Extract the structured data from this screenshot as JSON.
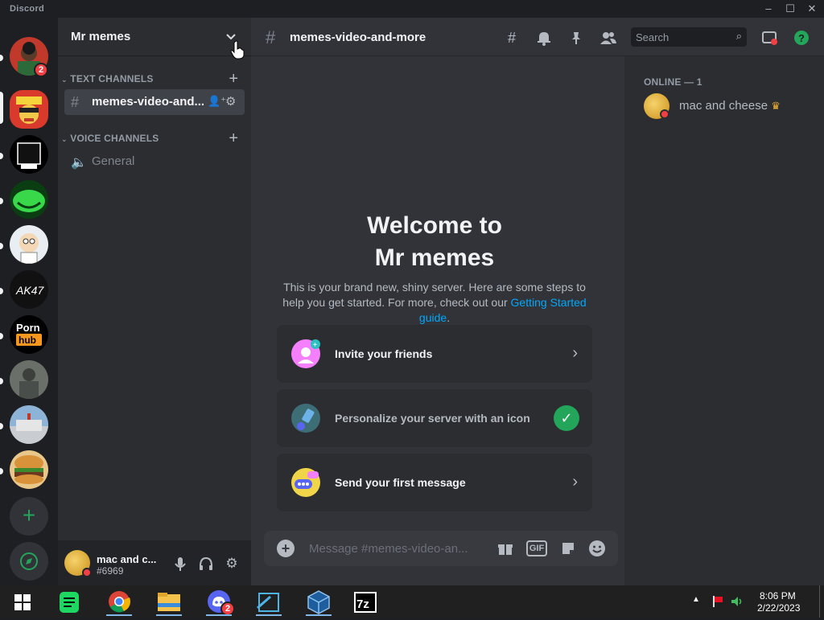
{
  "window": {
    "app_name": "Discord",
    "controls": [
      "minimize",
      "maximize",
      "close"
    ]
  },
  "guilds": {
    "items": [
      {
        "name": "guild-1",
        "badge": "2"
      },
      {
        "name": "guild-2",
        "active": true
      },
      {
        "name": "guild-3"
      },
      {
        "name": "guild-4"
      },
      {
        "name": "guild-5"
      },
      {
        "name": "guild-6",
        "label": "AK47"
      },
      {
        "name": "guild-7",
        "label": "Porn hub"
      },
      {
        "name": "guild-8"
      },
      {
        "name": "guild-9"
      },
      {
        "name": "guild-10"
      }
    ],
    "add_server_icon": "plus-icon",
    "explore_icon": "compass-icon"
  },
  "server": {
    "name": "Mr memes",
    "dropdown_icon": "chevron-down-icon"
  },
  "channels": {
    "text_category": "TEXT CHANNELS",
    "voice_category": "VOICE CHANNELS",
    "text": [
      {
        "label": "memes-video-and...",
        "active": true
      }
    ],
    "voice": [
      {
        "label": "General"
      }
    ]
  },
  "user": {
    "name": "mac and c...",
    "tag": "#6969",
    "status": "dnd"
  },
  "topbar": {
    "channel": "memes-video-and-more",
    "search_placeholder": "Search"
  },
  "welcome": {
    "title_line1": "Welcome to",
    "title_line2": "Mr memes",
    "desc_text": "This is your brand new, shiny server. Here are some steps to help you get started. For more, check out our ",
    "desc_link": "Getting Started guide",
    "desc_end": ".",
    "cards": [
      {
        "label": "Invite your friends",
        "done": false
      },
      {
        "label": "Personalize your server with an icon",
        "done": true
      },
      {
        "label": "Send your first message",
        "done": false
      }
    ]
  },
  "composer": {
    "placeholder": "Message #memes-video-an...",
    "gif_label": "GIF"
  },
  "members": {
    "header": "ONLINE — 1",
    "list": [
      {
        "name": "mac and cheese",
        "owner": true
      }
    ]
  },
  "taskbar": {
    "time": "8:06 PM",
    "date": "2/22/2023",
    "discord_badge": "2"
  },
  "colors": {
    "accent_green": "#23a55a",
    "status_red": "#f23f43",
    "link_blue": "#00a8fc"
  }
}
